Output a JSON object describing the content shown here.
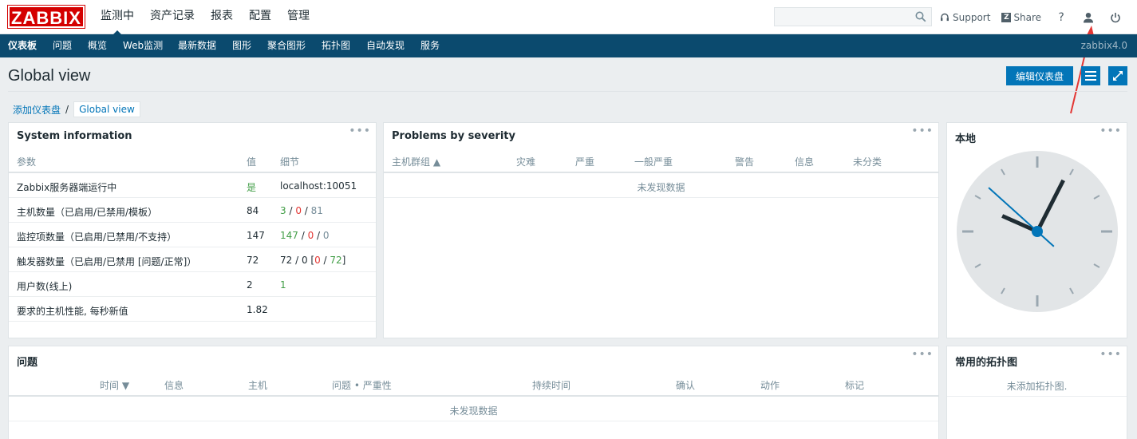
{
  "header": {
    "logo": "ZABBIX",
    "menu": [
      "监测中",
      "资产记录",
      "报表",
      "配置",
      "管理"
    ],
    "search_placeholder": "",
    "support": "Support",
    "share": "Share",
    "share_badge": "Z",
    "help": "?"
  },
  "subnav": {
    "items": [
      "仪表板",
      "问题",
      "概览",
      "Web监测",
      "最新数据",
      "图形",
      "聚合图形",
      "拓扑图",
      "自动发现",
      "服务"
    ],
    "version": "zabbix4.0"
  },
  "page": {
    "title": "Global view",
    "edit_button": "编辑仪表盘",
    "breadcrumb_link": "添加仪表盘",
    "breadcrumb_sep": "/",
    "breadcrumb_current": "Global view"
  },
  "sysinfo": {
    "title": "System information",
    "menu": "•••",
    "headers": [
      "参数",
      "值",
      "细节"
    ],
    "rows": [
      {
        "param": "Zabbix服务器端运行中",
        "value": "是",
        "detail": "localhost:10051"
      },
      {
        "param": "主机数量（已启用/已禁用/模板）",
        "value": "84",
        "d1": "3",
        "d2": "0",
        "d3": "81"
      },
      {
        "param": "监控项数量（已启用/已禁用/不支持）",
        "value": "147",
        "d1": "147",
        "d2": "0",
        "d3": "0"
      },
      {
        "param": "触发器数量（已启用/已禁用 [问题/正常]）",
        "value": "72",
        "d_prefix": "72 / 0 [",
        "d1": "0",
        "d2": "72",
        "d_suffix": "]"
      },
      {
        "param": "用户数(线上)",
        "value": "2",
        "detail": "1"
      },
      {
        "param": "要求的主机性能, 每秒新值",
        "value": "1.82",
        "detail": ""
      }
    ]
  },
  "problems_sev": {
    "title": "Problems by severity",
    "menu": "•••",
    "headers": [
      "主机群组 ▲",
      "灾难",
      "严重",
      "一般严重",
      "警告",
      "信息",
      "未分类"
    ],
    "nodata": "未发现数据"
  },
  "clock": {
    "title": "本地",
    "menu": "•••",
    "hour": 9.8,
    "minute": 4.5,
    "second": 52
  },
  "problems": {
    "title": "问题",
    "menu": "•••",
    "headers": [
      "时间 ▼",
      "信息",
      "主机",
      "问题 • 严重性",
      "持续时间",
      "确认",
      "动作",
      "标记"
    ],
    "nodata": "未发现数据"
  },
  "maps": {
    "title": "常用的拓扑图",
    "menu": "•••",
    "nodata": "未添加拓扑图."
  }
}
